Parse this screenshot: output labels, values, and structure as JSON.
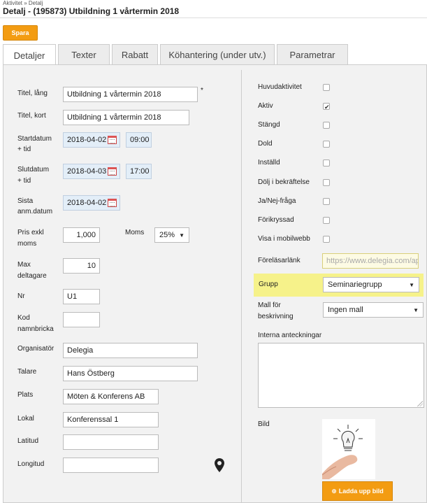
{
  "breadcrumb": "Aktivitet » Detalj",
  "page_title": "Detalj - (195873) Utbildning 1 vårtermin 2018",
  "save_label": "Spara",
  "tabs": [
    "Detaljer",
    "Texter",
    "Rabatt",
    "Köhantering (under utv.)",
    "Parametrar"
  ],
  "left": {
    "titel_lang_label": "Titel, lång",
    "titel_lang_value": "Utbildning 1 vårtermin 2018",
    "required_mark": "*",
    "titel_kort_label": "Titel, kort",
    "titel_kort_value": "Utbildning 1 vårtermin 2018",
    "start_label_1": "Startdatum",
    "start_label_2": "+ tid",
    "start_date": "2018-04-02",
    "start_time": "09:00",
    "slut_label_1": "Slutdatum",
    "slut_label_2": "+ tid",
    "slut_date": "2018-04-03",
    "slut_time": "17:00",
    "sista_label_1": "Sista",
    "sista_label_2": "anm.datum",
    "sista_date": "2018-04-02",
    "pris_label_1": "Pris exkl",
    "pris_label_2": "moms",
    "pris_value": "1,000",
    "moms_label": "Moms",
    "moms_value": "25%",
    "max_label_1": "Max",
    "max_label_2": "deltagare",
    "max_value": "10",
    "nr_label": "Nr",
    "nr_value": "U1",
    "kod_label_1": "Kod",
    "kod_label_2": "namnbricka",
    "kod_value": "",
    "org_label": "Organisatör",
    "org_value": "Delegia",
    "talare_label": "Talare",
    "talare_value": "Hans Östberg",
    "plats_label": "Plats",
    "plats_value": "Möten & Konferens AB",
    "lokal_label": "Lokal",
    "lokal_value": "Konferenssal 1",
    "latitud_label": "Latitud",
    "latitud_value": "",
    "longitud_label": "Longitud",
    "longitud_value": ""
  },
  "right": {
    "checkboxes": [
      {
        "label": "Huvudaktivitet",
        "checked": false
      },
      {
        "label": "Aktiv",
        "checked": true
      },
      {
        "label": "Stängd",
        "checked": false
      },
      {
        "label": "Dold",
        "checked": false
      },
      {
        "label": "Inställd",
        "checked": false
      },
      {
        "label": "Dölj i bekräftelse",
        "checked": false
      },
      {
        "label": "Ja/Nej-fråga",
        "checked": false
      },
      {
        "label": "Förikryssad",
        "checked": false
      },
      {
        "label": "Visa i mobilwebb",
        "checked": false
      }
    ],
    "forelasar_label": "Föreläsarlänk",
    "forelasar_placeholder": "https://www.delegia.com/ap",
    "grupp_label": "Grupp",
    "grupp_value": "Seminariegrupp",
    "mall_label_1": "Mall för",
    "mall_label_2": "beskrivning",
    "mall_value": "Ingen mall",
    "anteckningar_label": "Interna anteckningar",
    "bild_label": "Bild",
    "upload_label": "Ladda upp bild"
  },
  "colors": {
    "accent": "#f39c12",
    "highlight": "#f6f28a",
    "date_bg": "#e3eef8"
  }
}
